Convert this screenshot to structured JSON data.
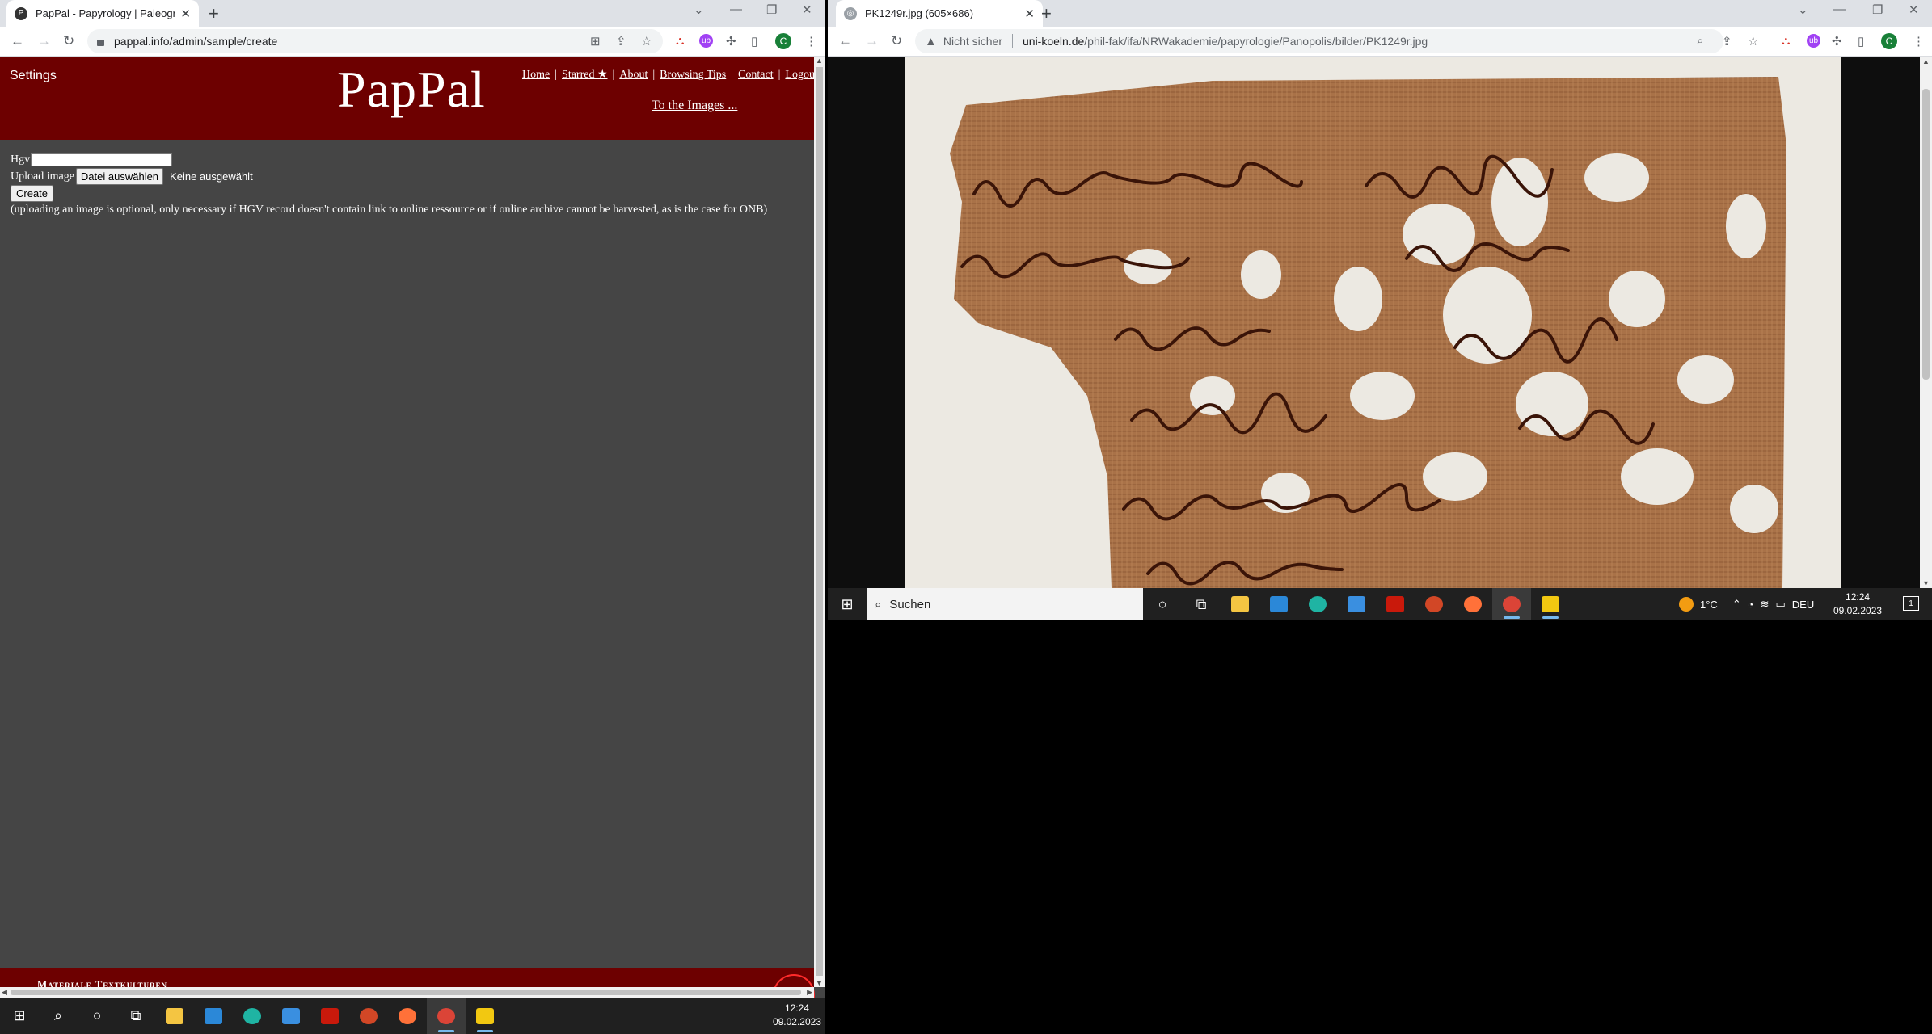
{
  "left_window": {
    "tab": {
      "title": "PapPal - Papyrology | Paleograph"
    },
    "url": "pappal.info/admin/sample/create",
    "page": {
      "settings_label": "Settings",
      "logo": "PapPal",
      "nav": {
        "home": "Home",
        "starred": "Starred ★",
        "about": "About",
        "browsing_tips": "Browsing Tips",
        "contact": "Contact",
        "logout": "Logou"
      },
      "to_images": "To the Images ...",
      "form": {
        "hgv_label": "Hgv",
        "hgv_value": "",
        "upload_label": "Upload image",
        "file_button": "Datei auswählen",
        "no_file": "Keine ausgewählt",
        "create_button": "Create",
        "note": "(uploading an image is optional, only necessary if HGV record doesn't contain link to online ressource or if online archive cannot be harvested, as is the case for ONB)"
      },
      "footer_text": "Materiale Textkulturen"
    },
    "taskbar": {
      "time": "12:24",
      "date": "09.02.2023"
    }
  },
  "right_window": {
    "tab": {
      "title": "PK1249r.jpg (605×686)"
    },
    "security_label": "Nicht sicher",
    "url_host": "uni-koeln.de",
    "url_path": "/phil-fak/ifa/NRWakademie/papyrologie/Panopolis/bilder/PK1249r.jpg",
    "taskbar": {
      "search_placeholder": "Suchen",
      "weather": "1°C",
      "language": "DEU",
      "time": "12:24",
      "date": "09.02.2023",
      "notification_count": "1"
    }
  },
  "colors": {
    "header_red": "#6d0000",
    "page_grey": "#454545",
    "papyrus": "#a97248",
    "ink": "#3a1408"
  }
}
